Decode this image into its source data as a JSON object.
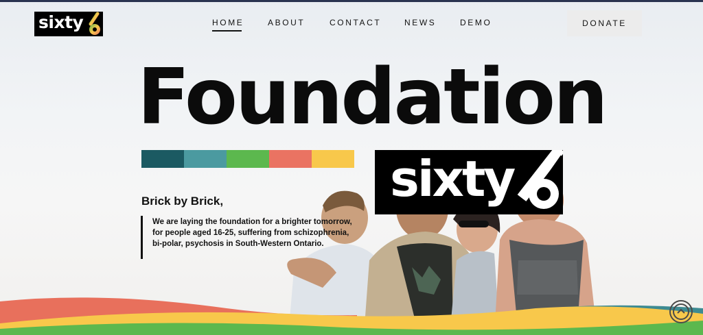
{
  "header": {
    "logo_text": "sixty",
    "nav": [
      {
        "label": "HOME",
        "active": true
      },
      {
        "label": "ABOUT",
        "active": false
      },
      {
        "label": "CONTACT",
        "active": false
      },
      {
        "label": "NEWS",
        "active": false
      },
      {
        "label": "DEMO",
        "active": false
      }
    ],
    "donate_label": "DONATE"
  },
  "hero": {
    "title": "Foundation",
    "logo_text": "sixty",
    "tagline": "Brick by Brick,",
    "description": "We are laying the foundation for a brighter tomorrow, for people aged 16-25, suffering from schizophrenia, bi-polar, psychosis in South-Western Ontario."
  },
  "colors": {
    "stripe_1": "#1b5a62",
    "stripe_2": "#4b9aa0",
    "stripe_3": "#5cb84e",
    "stripe_4": "#ea7362",
    "stripe_5": "#f8c84b",
    "accent_red": "#e8705c",
    "accent_yellow": "#f8c84b",
    "accent_green": "#5cb84e",
    "accent_teal": "#3d8b92",
    "top_border": "#2a3450"
  },
  "icons": {
    "scroll_top": "chevron-up-icon"
  }
}
